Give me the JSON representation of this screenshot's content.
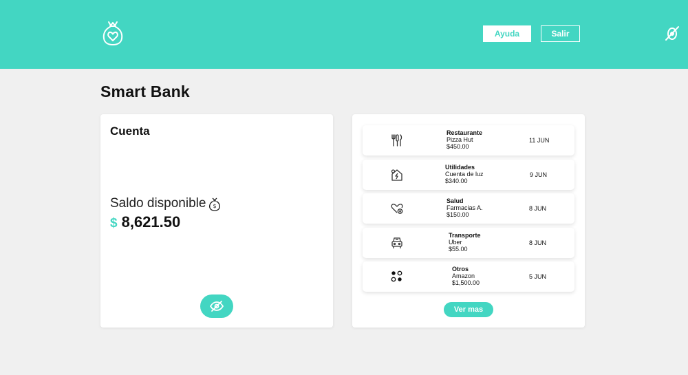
{
  "header": {
    "logo_icon": "money-bag-heart-icon",
    "help_label": "Ayuda",
    "logout_label": "Salir",
    "right_icon": "eye-off-icon",
    "brand_color": "#43d6c2"
  },
  "page": {
    "title": "Smart Bank"
  },
  "account": {
    "title": "Cuenta",
    "available_label": "Saldo disponible",
    "available_icon": "money-bag-emoji",
    "currency": "$",
    "balance": "8,621.50",
    "toggle_icon": "eye-off-icon"
  },
  "transactions": {
    "items": [
      {
        "icon": "utensils-icon",
        "category": "Restaurante",
        "merchant": "Pizza Hut",
        "amount": "$450.00",
        "date": "11 JUN"
      },
      {
        "icon": "house-bolt-icon",
        "category": "Utilidades",
        "merchant": "Cuenta de luz",
        "amount": "$340.00",
        "date": "9 JUN"
      },
      {
        "icon": "heart-plus-icon",
        "category": "Salud",
        "merchant": "Farmacias A.",
        "amount": "$150.00",
        "date": "8 JUN"
      },
      {
        "icon": "car-icon",
        "category": "Transporte",
        "merchant": "Uber",
        "amount": "$55.00",
        "date": "8 JUN"
      },
      {
        "icon": "dots-grid-icon",
        "category": "Otros",
        "merchant": "Amazon",
        "amount": "$1,500.00",
        "date": "5 JUN"
      }
    ],
    "more_label": "Ver mas"
  }
}
